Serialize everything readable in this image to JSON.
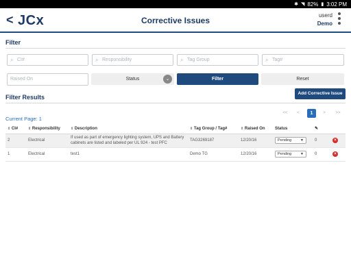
{
  "status_bar": {
    "battery": "82%",
    "time": "3:02 PM"
  },
  "header": {
    "logo": "JCx",
    "title": "Corrective Issues",
    "user_name": "userd",
    "user_role": "Demo"
  },
  "filter": {
    "heading": "Filter",
    "ci_placeholder": "CI#",
    "responsibility_placeholder": "Responsibility",
    "tag_group_placeholder": "Tag Group",
    "tag_placeholder": "Tag#",
    "raised_on_placeholder": "Raised On",
    "status_label": "Status",
    "filter_button": "Filter",
    "reset_button": "Reset"
  },
  "results": {
    "heading": "Filter Results",
    "add_button": "Add Corrective Issue",
    "current_page": "Current Page: 1",
    "pagination": {
      "first": "<<",
      "prev": "<",
      "page": "1",
      "next": ">",
      "last": ">>"
    },
    "columns": {
      "ci": "CI#",
      "responsibility": "Responsibility",
      "description": "Description",
      "tag": "Tag Group / Tag#",
      "raised_on": "Raised On",
      "status": "Status"
    },
    "rows": [
      {
        "ci": "2",
        "responsibility": "Electrical",
        "description": "If used as part of emergency lighting system, UPS and Battery cabinets are listed and labeled per UL 924 - test PFC",
        "tag": "TAG3269187",
        "raised_on": "12/20/16",
        "status": "Pending",
        "count": "0"
      },
      {
        "ci": "1",
        "responsibility": "Electrical",
        "description": "test1",
        "tag": "Demo TG",
        "raised_on": "12/20/16",
        "status": "Pending",
        "count": "0"
      }
    ]
  },
  "colors": {
    "primary": "#1e4a7e",
    "link": "#2a6ebb",
    "delete": "#d32f2f"
  }
}
